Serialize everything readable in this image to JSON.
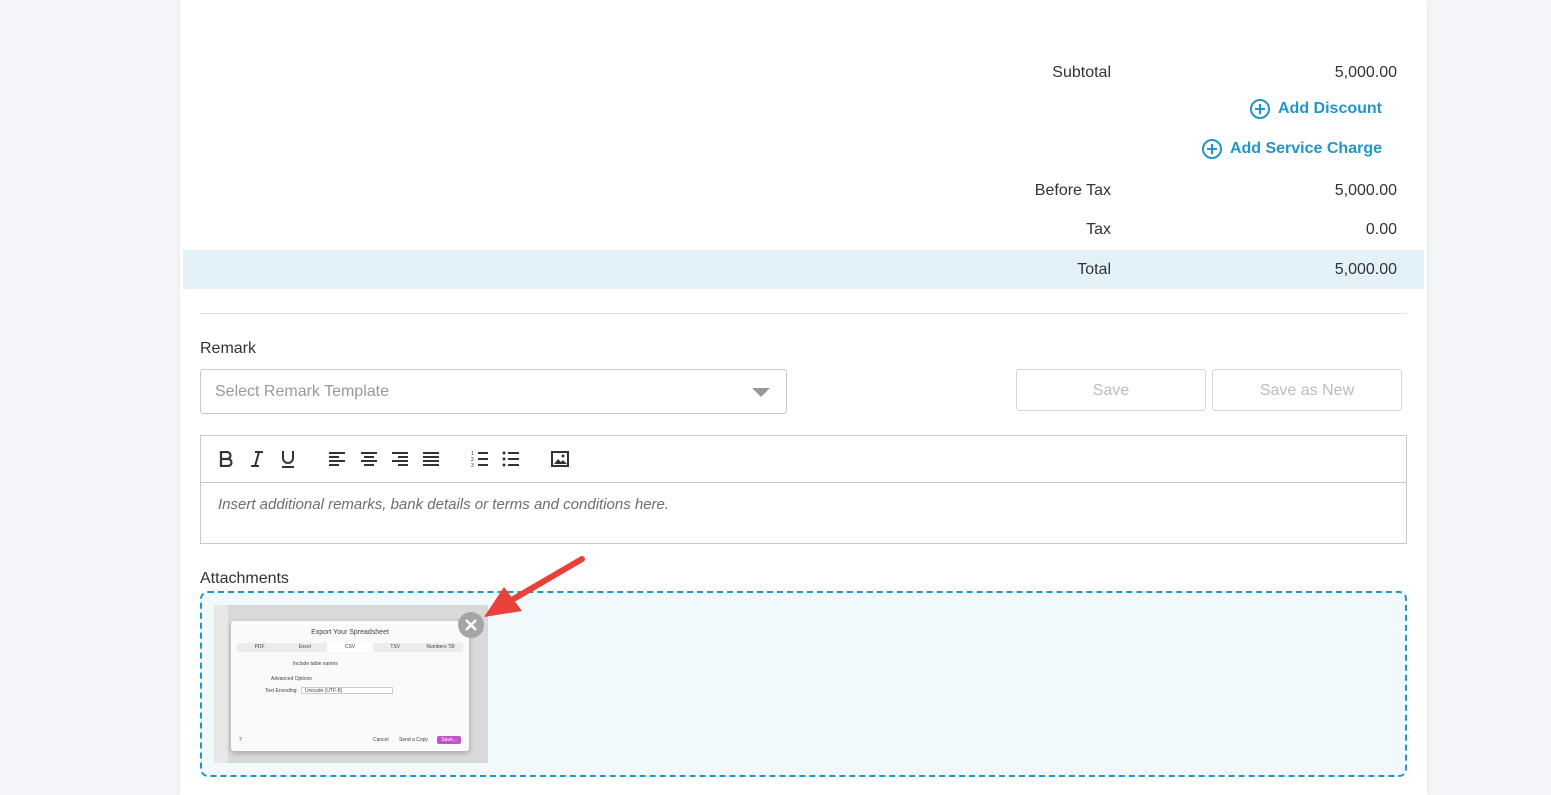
{
  "totals": {
    "subtotal": {
      "label": "Subtotal",
      "value": "5,000.00"
    },
    "add_discount": "Add Discount",
    "add_service_charge": "Add Service Charge",
    "before_tax": {
      "label": "Before Tax",
      "value": "5,000.00"
    },
    "tax": {
      "label": "Tax",
      "value": "0.00"
    },
    "total": {
      "label": "Total",
      "value": "5,000.00"
    }
  },
  "remark": {
    "label": "Remark",
    "template_placeholder": "Select Remark Template",
    "save_label": "Save",
    "save_as_new_label": "Save as New",
    "editor_placeholder": "Insert additional remarks, bank details or terms and conditions here."
  },
  "attachments": {
    "label": "Attachments",
    "thumbnail": {
      "title": "Export Your Spreadsheet",
      "tabs": [
        "PDF",
        "Excel",
        "CSV",
        "TSV",
        "Numbers '09"
      ],
      "selected_tab": "CSV",
      "include_table_names": "Include table names",
      "advanced_options": "Advanced Options",
      "text_encoding_label": "Text Encoding:",
      "text_encoding_value": "Unicode (UTF-8)",
      "help": "?",
      "cancel": "Cancel",
      "send_copy": "Send a Copy",
      "save": "Save..."
    }
  },
  "colors": {
    "accent": "#2196c9",
    "total_row_bg": "#e3f2f9",
    "dropzone_bg": "#f1f9fc",
    "annotation_arrow": "#e8403a"
  }
}
